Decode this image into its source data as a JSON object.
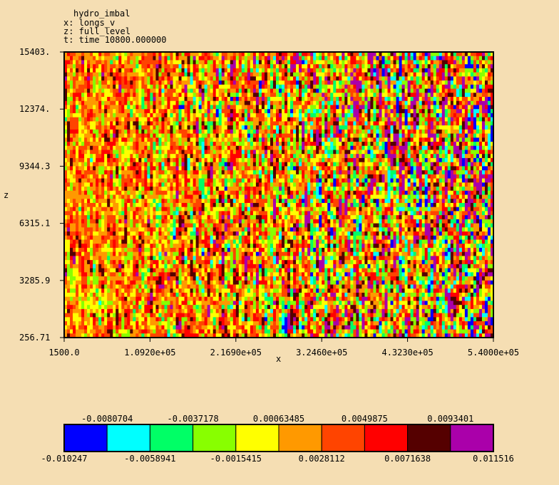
{
  "header": {
    "title": "hydro_imbal",
    "x_line": "x: longs_v",
    "z_line": "z: full_level",
    "t_line": "t: time 10800.000000"
  },
  "chart_data": {
    "type": "heatmap",
    "title": "hydro_imbal",
    "xlabel": "x",
    "ylabel": "z",
    "xlim": [
      1500.0,
      540000.0
    ],
    "ylim": [
      256.71,
      15403.0
    ],
    "x_ticks": [
      "1500.0",
      "1.0920e+05",
      "2.1690e+05",
      "3.2460e+05",
      "4.3230e+05",
      "5.4000e+05"
    ],
    "y_ticks": [
      "256.71",
      "3285.9",
      "6315.1",
      "9344.3",
      "12374.",
      "15403."
    ],
    "grid": false,
    "colorbar": {
      "min": -0.010247,
      "max": 0.011516,
      "top_labels": [
        "-0.0080704",
        "-0.0037178",
        "0.00063485",
        "0.0049875",
        "0.0093401"
      ],
      "bottom_labels": [
        "-0.010247",
        "-0.0058941",
        "-0.0015415",
        "0.0028112",
        "0.0071638",
        "0.011516"
      ],
      "colors": [
        "#0000ff",
        "#00ffff",
        "#00ff66",
        "#88ff00",
        "#ffff00",
        "#ff9900",
        "#ff4400",
        "#ff0000",
        "#550000",
        "#aa00aa"
      ]
    },
    "field": {
      "dominant_range": [
        -0.0015415,
        0.0071638
      ],
      "note_visible": "random noisy field, more extreme values toward larger x"
    }
  }
}
